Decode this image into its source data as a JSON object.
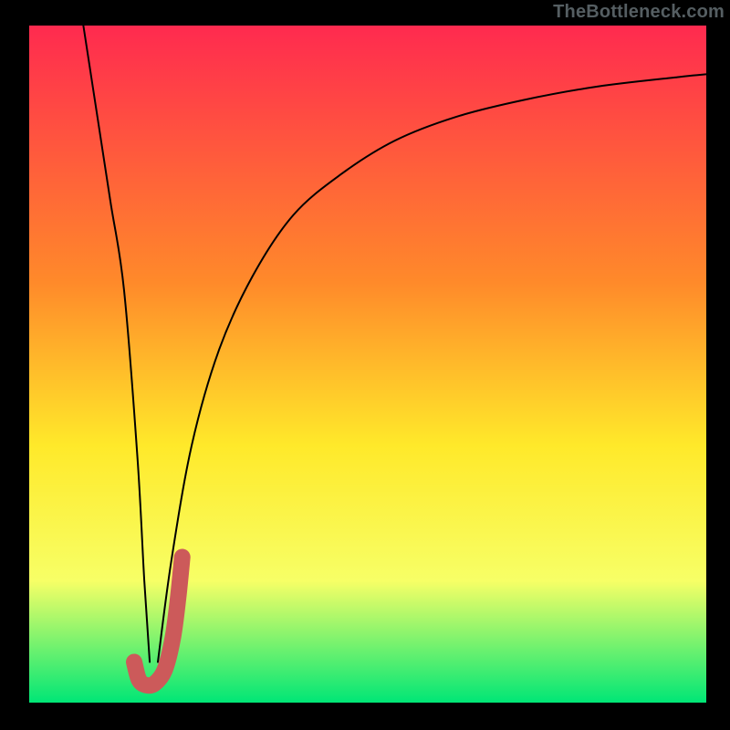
{
  "watermark": "TheBottleneck.com",
  "chart_data": {
    "type": "line",
    "title": "",
    "xlabel": "",
    "ylabel": "",
    "xlim": [
      0,
      100
    ],
    "ylim": [
      0,
      100
    ],
    "background_gradient": {
      "top": "#ff2a4f",
      "mid1": "#ff8a2a",
      "mid2": "#ffe92a",
      "mid3": "#f7ff66",
      "bottom": "#00e676"
    },
    "series": [
      {
        "name": "curve-left-descending",
        "color": "#000000",
        "width": 2,
        "x": [
          8,
          10,
          12,
          14,
          16,
          17,
          17.8
        ],
        "y": [
          100,
          87,
          74,
          61,
          36,
          18,
          6
        ]
      },
      {
        "name": "curve-right-rising",
        "color": "#000000",
        "width": 2,
        "x": [
          19,
          21,
          24,
          28,
          33,
          39,
          46,
          54,
          63,
          73,
          84,
          96,
          100
        ],
        "y": [
          6,
          21,
          38,
          52,
          63,
          72,
          78,
          83,
          86.5,
          89,
          91,
          92.4,
          92.8
        ]
      },
      {
        "name": "highlight-j-stroke",
        "color": "#cc5a5a",
        "width": 10,
        "x": [
          15.5,
          16.2,
          17.2,
          18.5,
          20,
          21.2,
          22.0,
          22.6
        ],
        "y": [
          6.0,
          3.4,
          2.6,
          2.8,
          4.8,
          9.5,
          15.5,
          21.5
        ]
      }
    ],
    "note": "Axes unlabeled in source image; x/y treated as 0–100 percentage of plot area. Values estimated from pixel positions."
  }
}
